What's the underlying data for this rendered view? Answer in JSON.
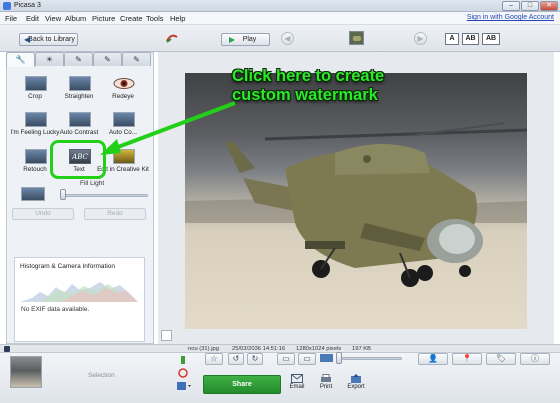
{
  "window": {
    "title": "Picasa 3"
  },
  "menu": {
    "items": [
      "File",
      "Edit",
      "View",
      "Album",
      "Picture",
      "Create",
      "Tools",
      "Help"
    ],
    "signin": "Sign in with Google Account"
  },
  "toolbar": {
    "back_label": "Back to Library",
    "play_label": "Play",
    "text_buttons": [
      "A",
      "AB",
      "AB"
    ]
  },
  "edit_panel": {
    "tabs": [
      "wrench-icon",
      "sun-icon",
      "brush-icon",
      "effects-brush-icon",
      "color-brush-icon"
    ],
    "tools": [
      {
        "label": "Crop"
      },
      {
        "label": "Straighten"
      },
      {
        "label": "Redeye"
      },
      {
        "label": "I'm Feeling Lucky"
      },
      {
        "label": "Auto Contrast"
      },
      {
        "label": "Auto Co..."
      },
      {
        "label": "Retouch"
      },
      {
        "label": "Text"
      },
      {
        "label": "Edit in Creative Kit"
      }
    ],
    "fill_light_label": "Fill Light",
    "fill_light_value": 0,
    "undo_label": "Undo",
    "redo_label": "Redo",
    "histogram_title": "Histogram & Camera Information",
    "exif_text": "No EXIF data available."
  },
  "annotation": {
    "line1": "Click here to create",
    "line2": "custom watermark",
    "color": "#2ee62a"
  },
  "status": {
    "filename": "nou (31).jpg",
    "datetime": "25/03/2036 14:51:16",
    "dimensions": "1280x1024 pixels",
    "size": "197 KB"
  },
  "tray": {
    "selection_label": "Selection",
    "share_label": "Share",
    "actions": [
      {
        "label": "Email",
        "icon": "email-icon"
      },
      {
        "label": "Print",
        "icon": "print-icon"
      },
      {
        "label": "Export",
        "icon": "export-icon"
      }
    ],
    "share_color": "#2e9e38"
  }
}
